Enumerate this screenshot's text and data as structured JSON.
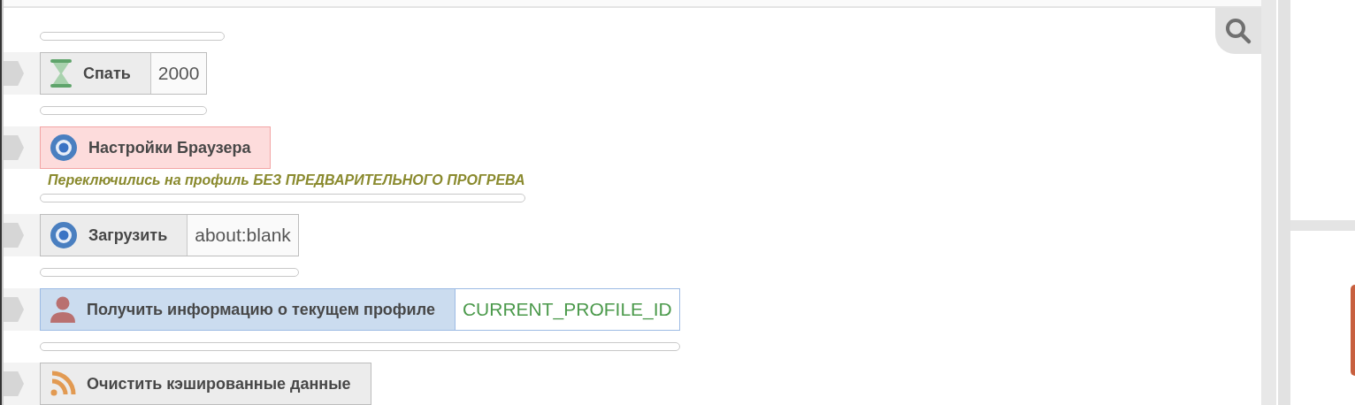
{
  "steps": [
    {
      "kind": "hourglass",
      "failed": false,
      "selected": false,
      "label": "Спать",
      "value": "2000",
      "variable": false
    },
    {
      "kind": "browser",
      "failed": true,
      "selected": false,
      "label": "Настройки Браузера",
      "note": "Переключились на профиль БЕЗ ПРЕДВАРИТЕЛЬНОГО ПРОГРЕВА"
    },
    {
      "kind": "browser",
      "failed": false,
      "selected": false,
      "label": "Загрузить",
      "value": "about:blank",
      "variable": false
    },
    {
      "kind": "user",
      "failed": false,
      "selected": true,
      "label": "Получить информацию о текущем профиле",
      "value": "CURRENT_PROFILE_ID",
      "variable": true
    },
    {
      "kind": "feed",
      "failed": false,
      "selected": false,
      "label": "Очистить кэшированные данные"
    }
  ]
}
